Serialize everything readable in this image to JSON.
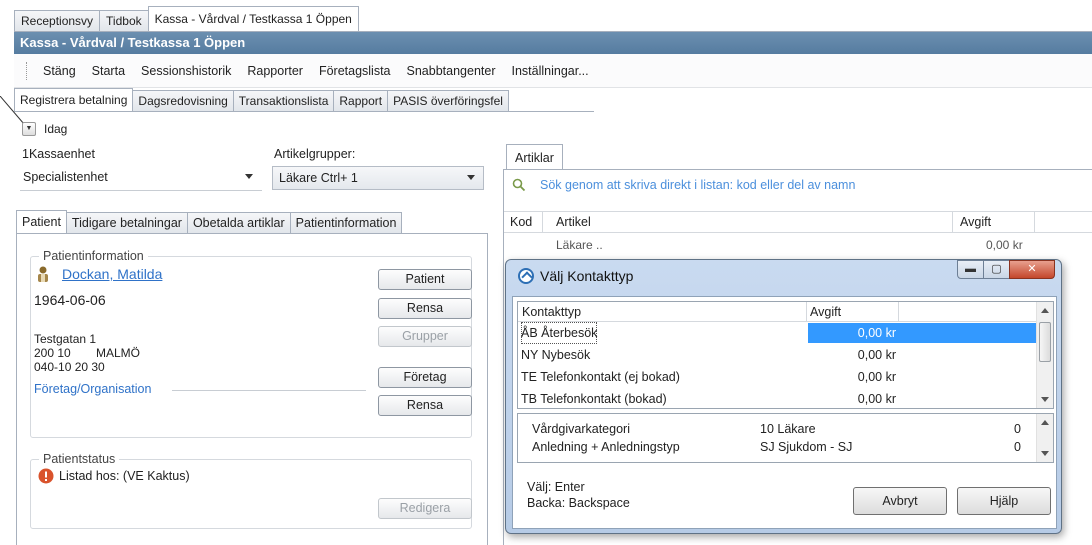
{
  "top_tabs": [
    "Receptionsvy",
    "Tidbok",
    "Kassa - Vårdval / Testkassa 1 Öppen"
  ],
  "title": "Kassa - Vårdval / Testkassa 1 Öppen",
  "menu": [
    "Stäng",
    "Starta",
    "Sessionshistorik",
    "Rapporter",
    "Företagslista",
    "Snabbtangenter",
    "Inställningar..."
  ],
  "sub_tabs": [
    "Registrera betalning",
    "Dagsredovisning",
    "Transaktionslista",
    "Rapport",
    "PASIS överföringsfel"
  ],
  "date_label": "Idag",
  "kassaenhet": {
    "label": "1Kassaenhet",
    "value": "Specialistenhet"
  },
  "artikelgrupper": {
    "label": "Artikelgrupper:",
    "value": "Läkare Ctrl+ 1"
  },
  "patient_tabs": [
    "Patient",
    "Tidigare betalningar",
    "Obetalda artiklar",
    "Patientinformation"
  ],
  "patientinfo": {
    "group_title": "Patientinformation",
    "name": "Dockan, Matilda",
    "dob": "1964-06-06",
    "street": "Testgatan 1",
    "postal": "200 10",
    "city": "MALMÖ",
    "phone": "040-10 20 30",
    "company_label": "Företag/Organisation",
    "buttons": {
      "patient": "Patient",
      "rensa1": "Rensa",
      "grupper": "Grupper",
      "foretag": "Företag",
      "rensa2": "Rensa"
    }
  },
  "patientstatus": {
    "group_title": "Patientstatus",
    "listad": "Listad hos: (VE Kaktus)",
    "redigera": "Redigera"
  },
  "artiklar": {
    "tab": "Artiklar",
    "search_placeholder": "Sök genom att skriva direkt i listan: kod eller del av namn",
    "columns": [
      "Kod",
      "Artikel",
      "Avgift"
    ],
    "row": {
      "artikel": "Läkare ..",
      "avgift": "0,00 kr"
    }
  },
  "dialog": {
    "title": "Välj Kontakttyp",
    "columns": [
      "Kontakttyp",
      "Avgift"
    ],
    "rows": [
      {
        "name": "ÅB Återbesök",
        "avgift": "0,00 kr",
        "selected": true
      },
      {
        "name": "NY Nybesök",
        "avgift": "0,00 kr"
      },
      {
        "name": "TE Telefonkontakt (ej bokad)",
        "avgift": "0,00 kr"
      },
      {
        "name": "TB Telefonkontakt (bokad)",
        "avgift": "0,00 kr"
      }
    ],
    "info": [
      {
        "label": "Vårdgivarkategori",
        "value": "10 Läkare",
        "num": "0"
      },
      {
        "label": "Anledning + Anledningstyp",
        "value": "SJ Sjukdom - SJ",
        "num": "0"
      }
    ],
    "hint1": "Välj: Enter",
    "hint2": "Backa: Backspace",
    "cancel": "Avbryt",
    "help": "Hjälp"
  }
}
